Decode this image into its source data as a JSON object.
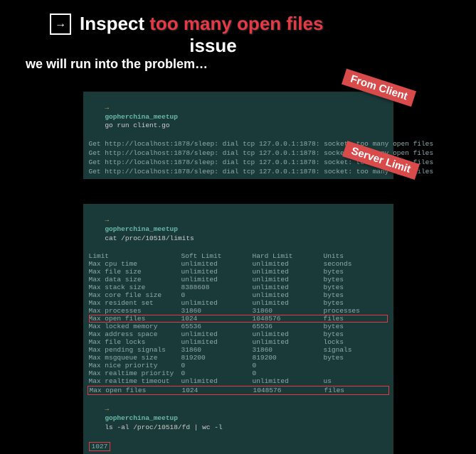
{
  "header": {
    "icon": "arrow-right-box",
    "title_white": "Inspect",
    "title_red": "too many open files",
    "title_line2": "issue",
    "subtitle": "we will run into the problem…"
  },
  "sticker1": "From Client",
  "sticker2": "Server Limit",
  "terminal1": {
    "prompt_arrow": "→",
    "prompt_path": "gopherchina_meetup",
    "command": "go run client.go",
    "lines": [
      "Get http://localhost:1878/sleep: dial tcp 127.0.0.1:1878: socket: too many open files",
      "Get http://localhost:1878/sleep: dial tcp 127.0.0.1:1878: socket: too many open files",
      "Get http://localhost:1878/sleep: dial tcp 127.0.0.1:1878: socket: too many open files",
      "Get http://localhost:1878/sleep: dial tcp 127.0.0.1:1878: socket: too many open files"
    ]
  },
  "terminal2": {
    "prompt_arrow": "→",
    "prompt_path": "gopherchina_meetup",
    "command": "cat /proc/10518/limits",
    "headers": [
      "Limit",
      "Soft Limit",
      "Hard Limit",
      "Units"
    ],
    "rows": [
      {
        "name": "Max cpu time",
        "soft": "unlimited",
        "hard": "unlimited",
        "units": "seconds"
      },
      {
        "name": "Max file size",
        "soft": "unlimited",
        "hard": "unlimited",
        "units": "bytes"
      },
      {
        "name": "Max data size",
        "soft": "unlimited",
        "hard": "unlimited",
        "units": "bytes"
      },
      {
        "name": "Max stack size",
        "soft": "8388608",
        "hard": "unlimited",
        "units": "bytes"
      },
      {
        "name": "Max core file size",
        "soft": "0",
        "hard": "unlimited",
        "units": "bytes"
      },
      {
        "name": "Max resident set",
        "soft": "unlimited",
        "hard": "unlimited",
        "units": "bytes"
      },
      {
        "name": "Max processes",
        "soft": "31860",
        "hard": "31860",
        "units": "processes"
      },
      {
        "name": "Max open files",
        "soft": "1024",
        "hard": "1048576",
        "units": "files",
        "highlight": true
      },
      {
        "name": "Max locked memory",
        "soft": "65536",
        "hard": "65536",
        "units": "bytes"
      },
      {
        "name": "Max address space",
        "soft": "unlimited",
        "hard": "unlimited",
        "units": "bytes"
      },
      {
        "name": "Max file locks",
        "soft": "unlimited",
        "hard": "unlimited",
        "units": "locks"
      },
      {
        "name": "Max pending signals",
        "soft": "31860",
        "hard": "31860",
        "units": "signals"
      },
      {
        "name": "Max msgqueue size",
        "soft": "819200",
        "hard": "819200",
        "units": "bytes"
      },
      {
        "name": "Max nice priority",
        "soft": "0",
        "hard": "0",
        "units": ""
      },
      {
        "name": "Max realtime priority",
        "soft": "0",
        "hard": "0",
        "units": ""
      },
      {
        "name": "Max realtime timeout",
        "soft": "unlimited",
        "hard": "unlimited",
        "units": "us"
      }
    ],
    "command2": "ls -al /proc/10518/fd | wc -l",
    "output2": "1027"
  }
}
